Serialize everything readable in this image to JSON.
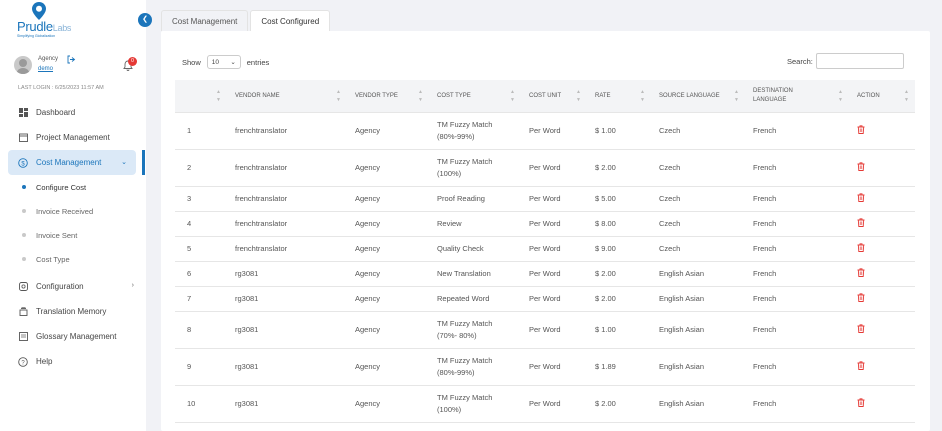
{
  "brand": {
    "name": "Prudle",
    "suffix": "Labs",
    "tagline": "Simplifying Globalization"
  },
  "user": {
    "role": "Agency",
    "name": "demo",
    "notification_count": "0",
    "last_login": "LAST LOGIN : 6/25/2023 11:57 AM"
  },
  "sidebar": {
    "items": [
      {
        "label": "Dashboard",
        "icon": "dashboard-icon"
      },
      {
        "label": "Project Management",
        "icon": "calendar-icon"
      },
      {
        "label": "Cost Management",
        "icon": "dollar-icon",
        "active": true
      },
      {
        "label": "Configuration",
        "icon": "configuration-icon"
      },
      {
        "label": "Translation Memory",
        "icon": "memory-icon"
      },
      {
        "label": "Glossary Management",
        "icon": "glossary-icon"
      },
      {
        "label": "Help",
        "icon": "help-icon"
      }
    ],
    "sub_items": [
      {
        "label": "Configure Cost",
        "current": true
      },
      {
        "label": "Invoice Received"
      },
      {
        "label": "Invoice Sent"
      },
      {
        "label": "Cost Type"
      }
    ]
  },
  "tabs": [
    {
      "label": "Cost Management"
    },
    {
      "label": "Cost Configured",
      "active": true
    }
  ],
  "table_controls": {
    "show_label": "Show",
    "entries_value": "10",
    "entries_label": "entries",
    "search_label": "Search:"
  },
  "table": {
    "headers": [
      "",
      "VENDOR NAME",
      "VENDOR TYPE",
      "COST TYPE",
      "COST UNIT",
      "RATE",
      "SOURCE LANGUAGE",
      "DESTINATION LANGUAGE",
      "ACTION"
    ],
    "rows": [
      {
        "no": "1",
        "vendor": "frenchtranslator",
        "type": "Agency",
        "cost_type": "TM Fuzzy Match (80%-99%)",
        "unit": "Per Word",
        "rate": "$ 1.00",
        "source": "Czech",
        "dest": "French"
      },
      {
        "no": "2",
        "vendor": "frenchtranslator",
        "type": "Agency",
        "cost_type": "TM Fuzzy Match (100%)",
        "unit": "Per Word",
        "rate": "$ 2.00",
        "source": "Czech",
        "dest": "French"
      },
      {
        "no": "3",
        "vendor": "frenchtranslator",
        "type": "Agency",
        "cost_type": "Proof Reading",
        "unit": "Per Word",
        "rate": "$ 5.00",
        "source": "Czech",
        "dest": "French"
      },
      {
        "no": "4",
        "vendor": "frenchtranslator",
        "type": "Agency",
        "cost_type": "Review",
        "unit": "Per Word",
        "rate": "$ 8.00",
        "source": "Czech",
        "dest": "French"
      },
      {
        "no": "5",
        "vendor": "frenchtranslator",
        "type": "Agency",
        "cost_type": "Quality Check",
        "unit": "Per Word",
        "rate": "$ 9.00",
        "source": "Czech",
        "dest": "French"
      },
      {
        "no": "6",
        "vendor": "rg3081",
        "type": "Agency",
        "cost_type": "New Translation",
        "unit": "Per Word",
        "rate": "$ 2.00",
        "source": "English Asian",
        "dest": "French"
      },
      {
        "no": "7",
        "vendor": "rg3081",
        "type": "Agency",
        "cost_type": "Repeated Word",
        "unit": "Per Word",
        "rate": "$ 2.00",
        "source": "English Asian",
        "dest": "French"
      },
      {
        "no": "8",
        "vendor": "rg3081",
        "type": "Agency",
        "cost_type": "TM Fuzzy Match (70%- 80%)",
        "unit": "Per Word",
        "rate": "$ 1.00",
        "source": "English Asian",
        "dest": "French"
      },
      {
        "no": "9",
        "vendor": "rg3081",
        "type": "Agency",
        "cost_type": "TM Fuzzy Match (80%-99%)",
        "unit": "Per Word",
        "rate": "$ 1.89",
        "source": "English Asian",
        "dest": "French"
      },
      {
        "no": "10",
        "vendor": "rg3081",
        "type": "Agency",
        "cost_type": "TM Fuzzy Match (100%)",
        "unit": "Per Word",
        "rate": "$ 2.00",
        "source": "English Asian",
        "dest": "French"
      }
    ]
  },
  "colors": {
    "accent": "#1b75bb",
    "active_bg": "#dbe9f7",
    "delete": "#e53935"
  }
}
